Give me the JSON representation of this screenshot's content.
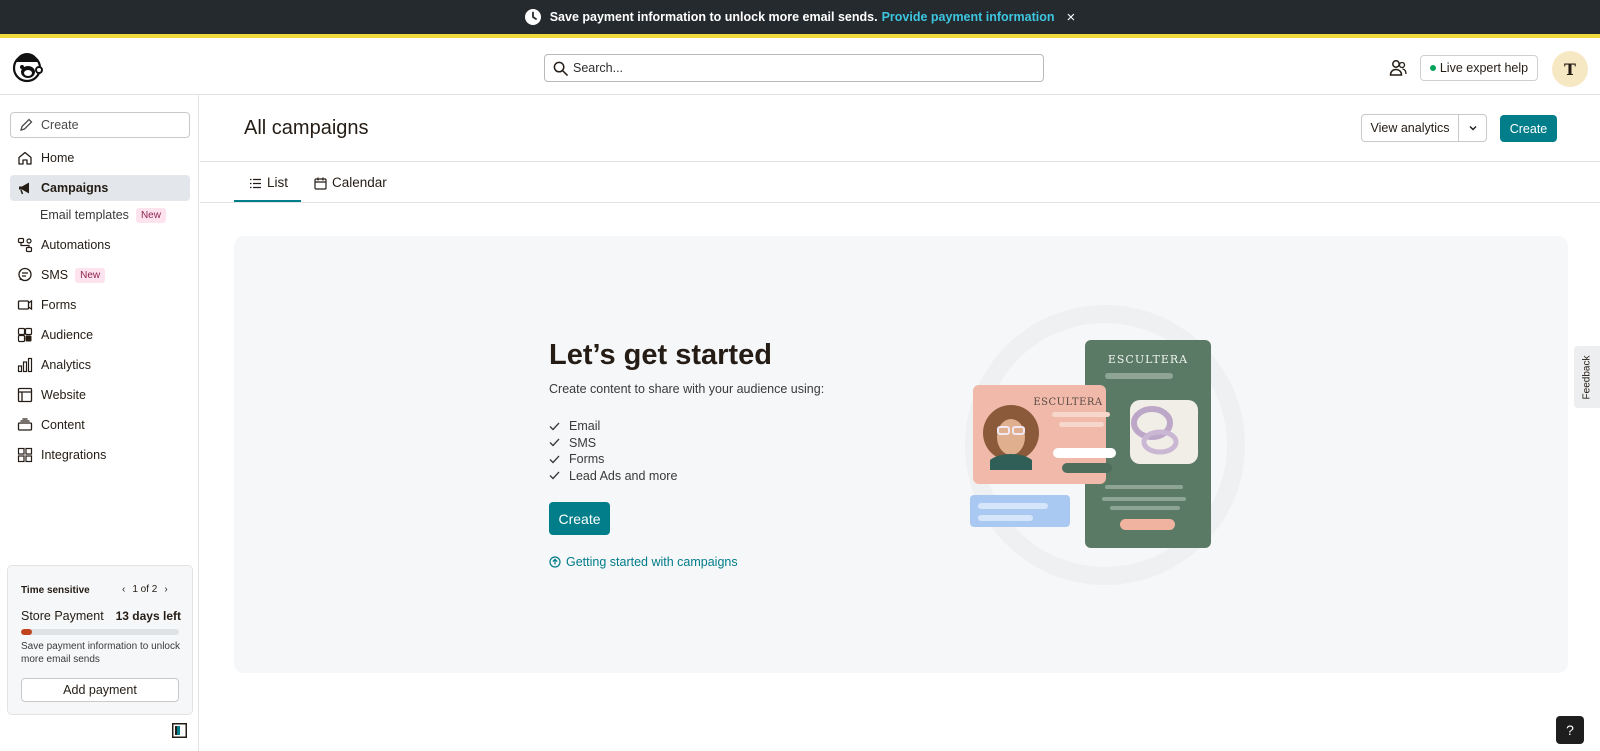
{
  "banner": {
    "message": "Save payment information to unlock more email sends.",
    "link": "Provide payment information",
    "close": "×"
  },
  "header": {
    "search_placeholder": "Search...",
    "expert_help": "Live expert help",
    "avatar_letter": "T"
  },
  "sidebar": {
    "create_label": "Create",
    "items": [
      {
        "label": "Home",
        "icon": "home-icon"
      },
      {
        "label": "Campaigns",
        "icon": "megaphone-icon",
        "active": true
      },
      {
        "label": "Email templates",
        "badge": "New",
        "sub": true
      },
      {
        "label": "Automations",
        "icon": "automations-icon"
      },
      {
        "label": "SMS",
        "icon": "sms-icon",
        "badge": "New"
      },
      {
        "label": "Forms",
        "icon": "forms-icon"
      },
      {
        "label": "Audience",
        "icon": "audience-icon"
      },
      {
        "label": "Analytics",
        "icon": "analytics-icon"
      },
      {
        "label": "Website",
        "icon": "website-icon"
      },
      {
        "label": "Content",
        "icon": "content-icon"
      },
      {
        "label": "Integrations",
        "icon": "integrations-icon"
      }
    ],
    "time_sensitive": {
      "heading": "Time sensitive",
      "pager": "1 of 2",
      "title": "Store Payment",
      "days_left": "13 days left",
      "progress": 0.07,
      "description": "Save payment information to unlock more email sends",
      "button": "Add payment"
    }
  },
  "main": {
    "title": "All campaigns",
    "view_analytics": "View analytics",
    "create": "Create",
    "tabs": [
      {
        "label": "List",
        "active": true
      },
      {
        "label": "Calendar"
      }
    ],
    "empty_state": {
      "title": "Let’s get started",
      "subtitle": "Create content to share with your audience using:",
      "checklist": [
        "Email",
        "SMS",
        "Forms",
        "Lead Ads and more"
      ],
      "create_button": "Create",
      "link": "Getting started with campaigns",
      "brand_text": "ESCULTERA"
    }
  },
  "feedback": "Feedback",
  "help": "?",
  "colors": {
    "accent": "#017e89",
    "banner_bg": "#242a2e",
    "banner_stripe": "#f0d93c",
    "link": "#3dc6e0",
    "progress": "#c0451d"
  }
}
